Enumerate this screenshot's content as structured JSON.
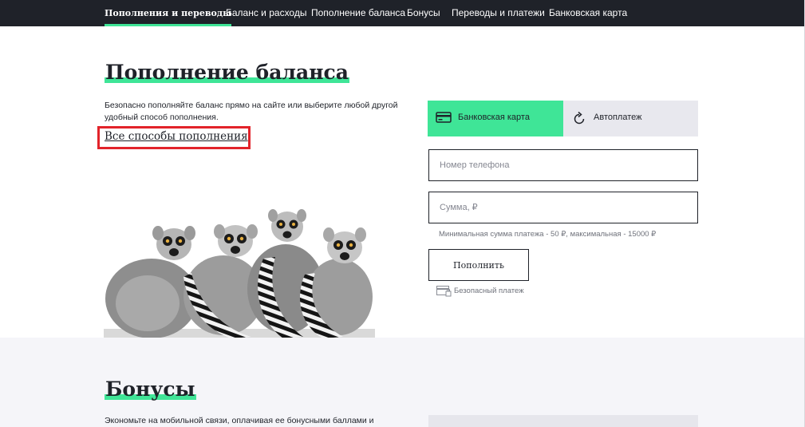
{
  "nav": {
    "items": [
      {
        "label": "Пополнения и переводы",
        "active": true
      },
      {
        "label": "Баланс и расходы"
      },
      {
        "label": "Пополнение баланса"
      },
      {
        "label": "Бонусы"
      },
      {
        "label": "Переводы и платежи"
      },
      {
        "label": "Банковская карта"
      }
    ]
  },
  "hero": {
    "title": "Пополнение баланса",
    "description": "Безопасно пополняйте баланс прямо на сайте или выберите любой другой удобный способ пополнения.",
    "all_methods_link": "Все способы пополнения"
  },
  "payment": {
    "tabs": [
      {
        "label": "Банковская карта",
        "icon": "credit-card-icon",
        "active": true
      },
      {
        "label": "Автоплатеж",
        "icon": "refresh-icon",
        "active": false
      }
    ],
    "phone_placeholder": "Номер телефона",
    "amount_placeholder": "Сумма, ₽",
    "hint": "Минимальная сумма платежа - 50 ₽, максимальная - 15000 ₽",
    "submit_label": "Пополнить",
    "secure_label": "Безопасный платеж"
  },
  "bonus": {
    "title": "Бонусы",
    "description": "Экономьте на мобильной связи, оплачивая ее бонусными баллами и"
  },
  "colors": {
    "accent": "#3fe597",
    "nav_bg": "#1f2229",
    "highlight_box": "#e2232a",
    "section_bg": "#f5f5f9"
  }
}
